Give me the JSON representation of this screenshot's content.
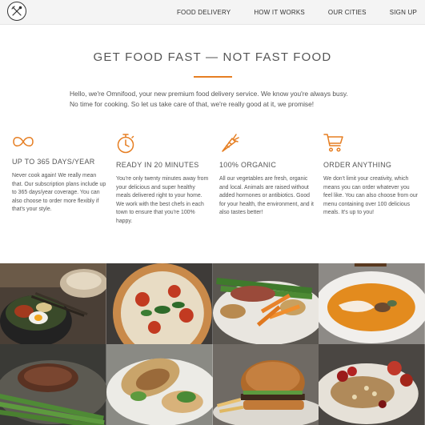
{
  "nav": {
    "links": [
      "FOOD DELIVERY",
      "HOW IT WORKS",
      "OUR CITIES",
      "SIGN UP"
    ]
  },
  "section": {
    "title": "GET FOOD FAST — NOT FAST FOOD",
    "intro": "Hello, we're Omnifood, your new premium food delivery service. We know you're always busy. No time for cooking. So let us take care of that, we're really good at it, we promise!"
  },
  "features": [
    {
      "icon": "infinity-icon",
      "title": "UP TO 365 DAYS/YEAR",
      "text": "Never cook again! We really mean that. Our subscription plans include up to 365 days/year coverage. You can also choose to order more flexibly if that's your style."
    },
    {
      "icon": "stopwatch-icon",
      "title": "READY IN 20 MINUTES",
      "text": "You're only twenty minutes away from your delicious and super healthy meals delivered right to your home. We work with the best chefs in each town to ensure that you're 100% happy."
    },
    {
      "icon": "carrot-icon",
      "title": "100% ORGANIC",
      "text": "All our vegetables are fresh, organic and local. Animals are raised without added hormones or antibiotics. Good for your health, the environment, and it also tastes better!"
    },
    {
      "icon": "cart-icon",
      "title": "ORDER ANYTHING",
      "text": "We don't limit your creativity, which means you can order whatever you feel like. You can also choose from our menu containing over 100 delicious meals. It's up to you!"
    }
  ],
  "colors": {
    "accent": "#e67e22",
    "nav_bg": "#f4f4f4",
    "text": "#555555"
  }
}
